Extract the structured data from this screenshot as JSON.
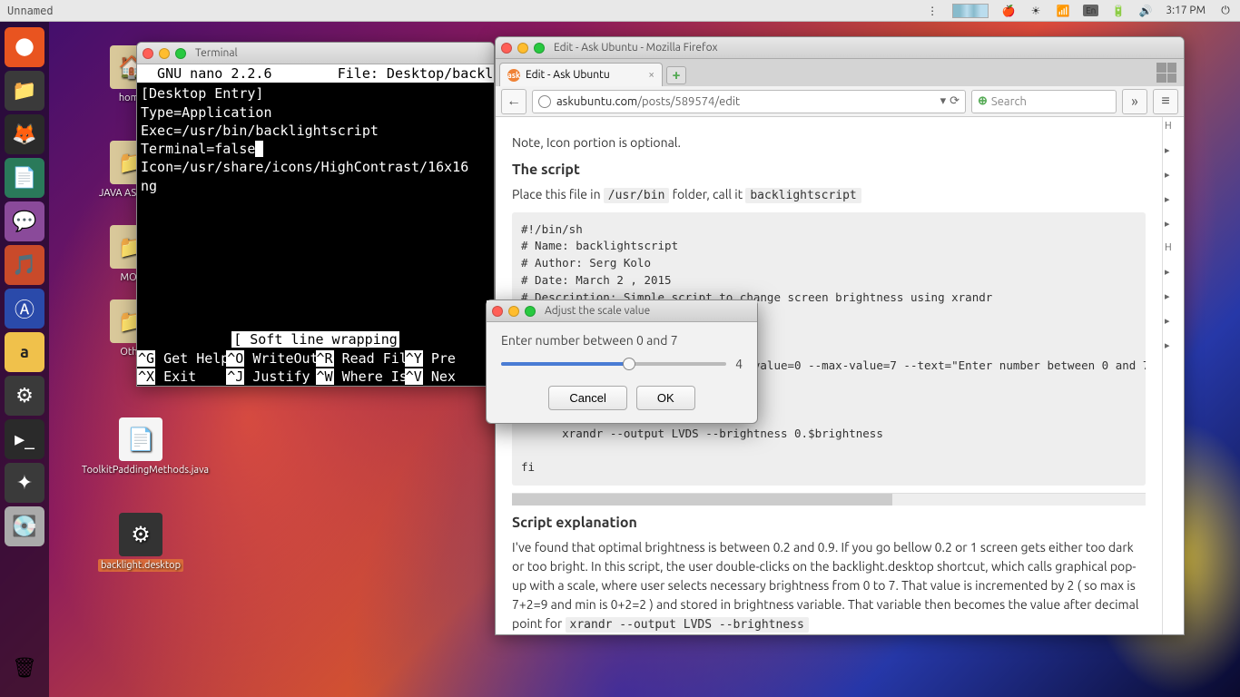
{
  "menubar": {
    "title": "Unnamed",
    "lang": "En",
    "time": "3:17 PM"
  },
  "desktop": {
    "home": "home",
    "java_assign": "JAVA ASSIGNA",
    "movies": "MOV",
    "other": "Othe",
    "toolkit": "ToolkitPaddingMethods.java",
    "backlight": "backlight.desktop"
  },
  "terminal": {
    "title": "Terminal",
    "nano_header": "  GNU nano 2.2.6        File: Desktop/backl",
    "lines": [
      "[Desktop Entry]",
      "Type=Application",
      "Exec=/usr/bin/backlightscript",
      "Terminal=false",
      "Icon=/usr/share/icons/HighContrast/16x16",
      "ng"
    ],
    "status": "[ Soft line wrapping",
    "shortcuts": [
      {
        "k": "^G",
        "l": "Get Help"
      },
      {
        "k": "^O",
        "l": "WriteOut"
      },
      {
        "k": "^R",
        "l": "Read Fil"
      },
      {
        "k": "^Y",
        "l": "Pre"
      },
      {
        "k": "^X",
        "l": "Exit"
      },
      {
        "k": "^J",
        "l": "Justify"
      },
      {
        "k": "^W",
        "l": "Where Is"
      },
      {
        "k": "^V",
        "l": "Nex"
      }
    ]
  },
  "firefox": {
    "window_title": "Edit - Ask Ubuntu - Mozilla Firefox",
    "tab_title": "Edit - Ask Ubuntu",
    "url_host": "askubuntu.com",
    "url_path": "/posts/589574/edit",
    "search_placeholder": "Search",
    "content": {
      "note": "Note, Icon portion is optional.",
      "h_script": "The script",
      "place_pre": "Place this file in ",
      "place_code1": "/usr/bin",
      "place_mid": " folder, call it ",
      "place_code2": "backlightscript",
      "codeblock": "#!/bin/sh\n# Name: backlightscript\n# Author: Serg Kolo\n# Date: March 2 , 2015\n# Description: Simple script to change screen brightness using xrandr\n#              no sudo needed\n\n\nbrightness=$(zenity --scale --min-value=0 --max-value=7 --text=\"Enter number between 0 and 7\"\n\n\n    then\n      xrandr --output LVDS --brightness 0.$brightness\n\nfi",
      "h_explain": "Script explanation",
      "explain_pre": "I've found that optimal brightness is between 0.2 and 0.9. If you go bellow 0.2 or 1 screen gets either too dark or too bright. In this script, the user double-clicks on the backlight.desktop shortcut, which calls graphical pop-up with a scale, where user selects necessary brightness from 0 to 7. That value is incremented by 2 ( so max is 7+2=9 and min is 0+2=2 ) and stored in brightness variable. That variable then becomes the value after decimal point for ",
      "explain_code": "xrandr --output LVDS --brightness"
    }
  },
  "dialog": {
    "title": "Adjust the scale value",
    "prompt": "Enter number between 0 and 7",
    "value": "4",
    "cancel": "Cancel",
    "ok": "OK"
  }
}
